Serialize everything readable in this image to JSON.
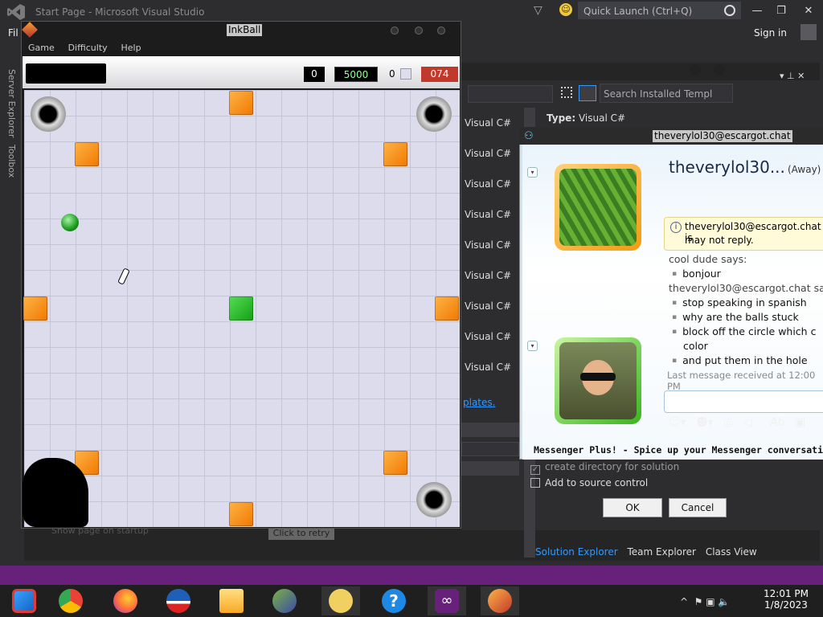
{
  "vs": {
    "title": "Start Page - Microsoft Visual Studio",
    "quick_launch": "Quick Launch (Ctrl+Q)",
    "menu_file": "Fil",
    "sign_in": "Sign in",
    "side_tabs": [
      "Server Explorer",
      "Toolbox"
    ],
    "search_templates": "Search Installed Templ",
    "type_label": "Type:",
    "type_value": "Visual C#",
    "template_items": [
      "Visual C#",
      "Visual C#",
      "Visual C#",
      "Visual C#",
      "Visual C#",
      "Visual C#",
      "Visual C#",
      "Visual C#",
      "Visual C#"
    ],
    "templates_link": "plates.",
    "create_dir": "create directory for solution",
    "add_source_control": "Add to source control",
    "ok": "OK",
    "cancel": "Cancel",
    "bottom_tabs": [
      "Solution Explorer",
      "Team Explorer",
      "Class View"
    ],
    "retry": "Click to retry",
    "show_page": "Show page on startup",
    "accent": "#68217a"
  },
  "inkball": {
    "title": "InkBall",
    "menu": [
      "Game",
      "Difficulty",
      "Help"
    ],
    "count": "0",
    "score": "5000",
    "ink": "0",
    "timer": "074"
  },
  "messenger": {
    "title": "theverylol30@escargot.chat",
    "contact_name": "theverylol30...",
    "status": "(Away)",
    "info_line1": "theverylol30@escargot.chat is",
    "info_line2": "may not reply.",
    "conversation": [
      {
        "kind": "sender",
        "text": "cool dude says:"
      },
      {
        "kind": "msg",
        "text": "bonjour"
      },
      {
        "kind": "sender",
        "text": "theverylol30@escargot.chat sa"
      },
      {
        "kind": "msg",
        "text": "stop speaking in spanish"
      },
      {
        "kind": "msg",
        "text": "why are the balls stuck"
      },
      {
        "kind": "msg",
        "text": "block off the circle which c"
      },
      {
        "kind": "cont",
        "text": "color"
      },
      {
        "kind": "msg",
        "text": "and put them in the hole"
      }
    ],
    "last_received": "Last message received at 12:00 PM",
    "plus_banner": "Messenger Plus! - Spice up your Messenger conversations and"
  },
  "taskbar": {
    "time": "12:01 PM",
    "date": "1/8/2023",
    "icons": [
      "control-panel-icon",
      "chrome-icon",
      "firefox-icon",
      "obama-logo-icon",
      "file-explorer-icon",
      "network-people-icon",
      "messenger-buddy-icon",
      "help-icon",
      "visual-studio-icon",
      "inkball-icon"
    ]
  }
}
